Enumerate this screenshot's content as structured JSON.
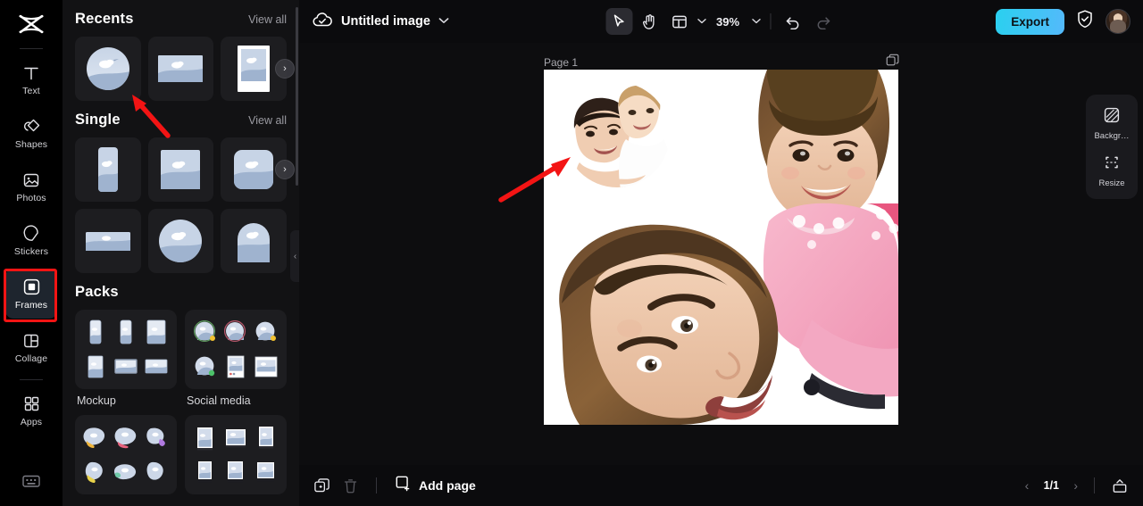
{
  "rail": {
    "logo_icon": "capcut-logo-icon",
    "items": [
      {
        "label": "Text",
        "icon": "text-icon",
        "active": false
      },
      {
        "label": "Shapes",
        "icon": "shapes-icon",
        "active": false
      },
      {
        "label": "Photos",
        "icon": "photos-icon",
        "active": false
      },
      {
        "label": "Stickers",
        "icon": "stickers-icon",
        "active": false
      },
      {
        "label": "Frames",
        "icon": "frames-icon",
        "active": true
      },
      {
        "label": "Collage",
        "icon": "collage-icon",
        "active": false
      },
      {
        "label": "Apps",
        "icon": "apps-icon",
        "active": false
      }
    ],
    "bottom_icon": "keyboard-icon"
  },
  "panel": {
    "sections": [
      {
        "title": "Recents",
        "view_all": "View all"
      },
      {
        "title": "Single",
        "view_all": "View all"
      },
      {
        "title": "Packs",
        "view_all": ""
      }
    ],
    "packs": [
      {
        "name": "Mockup"
      },
      {
        "name": "Social media"
      },
      {
        "name": ""
      },
      {
        "name": ""
      }
    ],
    "next_arrow": "›",
    "collapse_arrow": "‹"
  },
  "topbar": {
    "cloud_icon": "cloud-saved-icon",
    "doc_title": "Untitled image",
    "title_chevron": "chevron-down-icon",
    "tools": [
      {
        "name": "select-tool",
        "icon": "cursor-icon",
        "active": true
      },
      {
        "name": "hand-tool",
        "icon": "hand-icon",
        "active": false
      },
      {
        "name": "layout-tool",
        "icon": "layout-icon",
        "active": false
      }
    ],
    "zoom_value": "39%",
    "undo_icon": "undo-icon",
    "redo_icon": "redo-icon",
    "export_label": "Export",
    "shield_icon": "shield-check-icon",
    "avatar_icon": "user-avatar"
  },
  "canvas": {
    "page_label": "Page 1",
    "page_copy_icon": "duplicate-page-icon"
  },
  "rightpanel": {
    "items": [
      {
        "label": "Backgr…",
        "icon": "background-icon"
      },
      {
        "label": "Resize",
        "icon": "resize-icon"
      }
    ]
  },
  "bottombar": {
    "duplicate_icon": "duplicate-icon",
    "delete_icon": "trash-icon",
    "add_page_label": "Add page",
    "add_page_icon": "add-page-icon",
    "prev_icon": "‹",
    "page_indicator": "1/1",
    "next_icon": "›",
    "export_box_icon": "export-box-icon"
  },
  "colors": {
    "accent": "#2ad0ef",
    "annotation": "#f31414",
    "panel_bg": "#121214",
    "rail_bg": "#000000",
    "active_item_bg": "#1e252e"
  }
}
